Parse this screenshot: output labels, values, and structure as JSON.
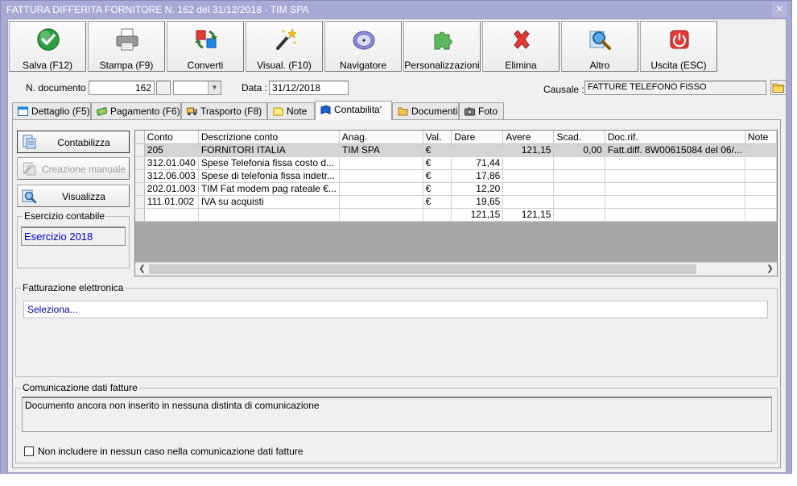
{
  "window": {
    "title": "FATTURA DIFFERITA FORNITORE N. 162 del 31/12/2018 - TIM SPA",
    "close_symbol": "×"
  },
  "toolbar": {
    "buttons": [
      {
        "label": "Salva (F12)",
        "icon": "check-circle-icon",
        "color": "#2ea043"
      },
      {
        "label": "Stampa (F9)",
        "icon": "printer-icon",
        "color": "#7a7a7a"
      },
      {
        "label": "Converti",
        "icon": "convert-icon",
        "color": "#2e7d32"
      },
      {
        "label": "Visual. (F10)",
        "icon": "magic-wand-icon",
        "color": "#333333"
      },
      {
        "label": "Navigatore",
        "icon": "compass-icon",
        "color": "#6a5acd"
      },
      {
        "label": "Personalizzazioni",
        "icon": "puzzle-icon",
        "color": "#5cb85c"
      },
      {
        "label": "Elimina",
        "icon": "delete-x-icon",
        "color": "#e53935"
      },
      {
        "label": "Altro",
        "icon": "magnifier-icon",
        "color": "#1e88e5"
      },
      {
        "label": "Uscita (ESC)",
        "icon": "power-icon",
        "color": "#e53935"
      }
    ]
  },
  "header": {
    "doc_number_label": "N. documento :",
    "doc_number_value": "162",
    "date_label": "Data :",
    "date_value": "31/12/2018",
    "causale_label": "Causale :",
    "causale_value": "FATTURE TELEFONO FISSO"
  },
  "tabs": [
    {
      "label": "Dettaglio (F5)",
      "icon": "calendar-icon"
    },
    {
      "label": "Pagamento (F6)",
      "icon": "money-icon"
    },
    {
      "label": "Trasporto (F8)",
      "icon": "truck-icon"
    },
    {
      "label": "Note",
      "icon": "note-icon"
    },
    {
      "label": "Contabilita'",
      "icon": "book-icon"
    },
    {
      "label": "Documenti",
      "icon": "folder-icon"
    },
    {
      "label": "Foto",
      "icon": "camera-icon"
    }
  ],
  "active_tab": "Contabilita'",
  "side": {
    "contabilizza": "Contabilizza",
    "creazione_manuale": "Creazione manuale",
    "visualizza": "Visualizza",
    "esercizio_title": "Esercizio contabile",
    "esercizio_value": "Esercizio 2018"
  },
  "grid": {
    "columns": [
      "Conto",
      "Descrizione conto",
      "Anag.",
      "Val.",
      "Dare",
      "Avere",
      "Scad.",
      "Doc.rif.",
      "Note"
    ],
    "rows": [
      [
        "205",
        "FORNITORI ITALIA",
        "TIM SPA",
        "€",
        "",
        "121,15",
        "0,00",
        "Fatt.diff. 8W00615084 del 06/...",
        ""
      ],
      [
        "312.01.040",
        "Spese Telefonia fissa costo d...",
        "",
        "€",
        "71,44",
        "",
        "",
        "",
        ""
      ],
      [
        "312.06.003",
        "Spese di telefonia fissa indetr...",
        "",
        "€",
        "17,86",
        "",
        "",
        "",
        ""
      ],
      [
        "202.01.003",
        "TIM Fat modem pag rateale €...",
        "",
        "€",
        "12,20",
        "",
        "",
        "",
        ""
      ],
      [
        "111.01.002",
        "IVA su acquisti",
        "",
        "€",
        "19,65",
        "",
        "",
        "",
        ""
      ],
      [
        "",
        "",
        "",
        "",
        "121,15",
        "121,15",
        "",
        "",
        ""
      ]
    ]
  },
  "fattura_elettronica": {
    "title": "Fatturazione elettronica",
    "value": "Seleziona..."
  },
  "comunicazione": {
    "title": "Comunicazione dati fatture",
    "memo": "Documento ancora non inserito in nessuna distinta di comunicazione",
    "checkbox_label": "Non includere in nessun caso nella comunicazione dati fatture"
  }
}
